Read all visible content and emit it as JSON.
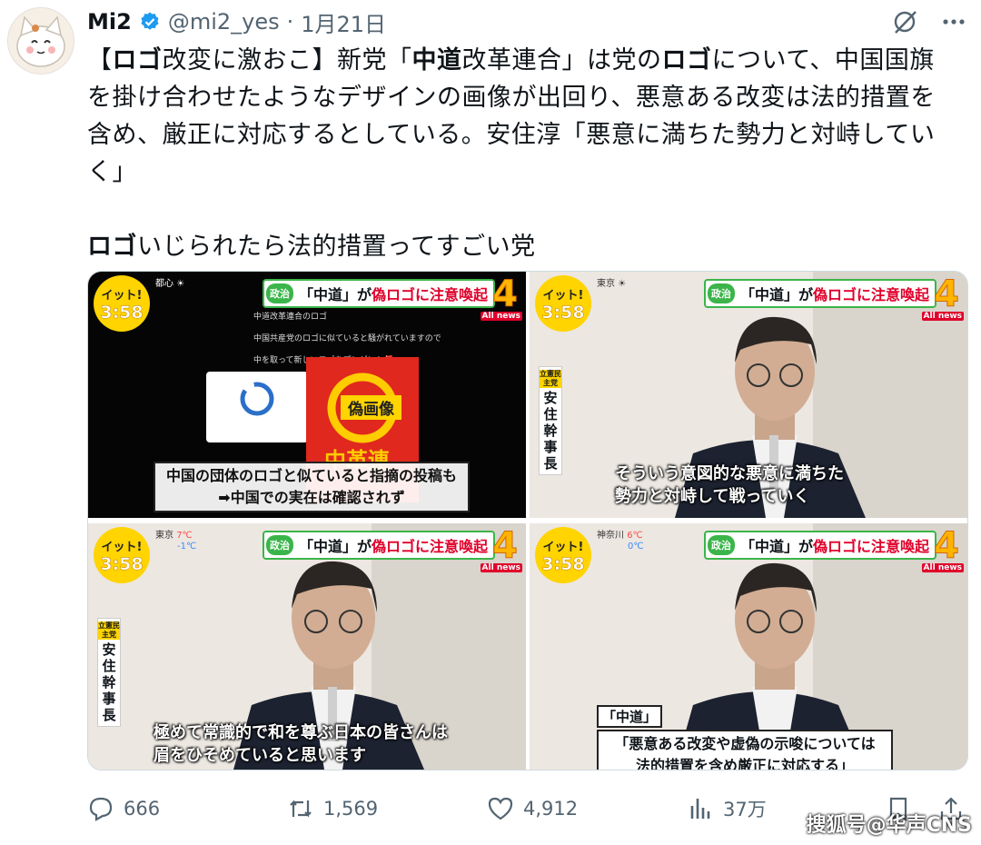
{
  "header": {
    "display_name": "Mi2",
    "handle": "@mi2_yes",
    "separator": "·",
    "date": "1月21日"
  },
  "tweet": {
    "line1_a": "【",
    "line1_b": "ロゴ",
    "line1_c": "改変に激おこ】新党「",
    "line1_d": "中道",
    "line1_e": "改革連合」は党の",
    "line1_f": "ロゴ",
    "line1_g": "について、中国国旗",
    "line2": "を掛け合わせたようなデザインの画像が出回り、悪意ある改変は法的措置を",
    "line3": "含め、厳正に対応するとしている。安住淳「悪意に満ちた勢力と対峙してい",
    "line4": "く」",
    "line5_a": "ロゴ",
    "line5_b": "いじられたら法的措置ってすごい党"
  },
  "media": {
    "itto_label": "イット!",
    "clock": "3:58",
    "topic_tag": "政治",
    "topic_a": "「中道」が",
    "topic_b": "偽ロゴに注意喚起",
    "channel_num": "4",
    "allnews": "All news",
    "frame1": {
      "weather": "都心",
      "line_a": "中道改革連合のロゴ",
      "line_b": "中国共産党のロゴに似ていると騒がれていますので",
      "line_c": "中を取って新しいロゴをプレゼント🎁",
      "fake_label": "偽画像",
      "red_text": "中革連",
      "caption_1": "中国の団体のロゴと似ていると指摘の投稿も",
      "caption_2": "➡中国での実在は確認されず"
    },
    "frame2": {
      "weather": "東京",
      "name_party": "立憲民主党",
      "name": "安住幹事長",
      "sub_1": "そういう意図的な悪意に満ちた",
      "sub_2": "勢力と対峙して戦っていく"
    },
    "frame3": {
      "weather_city": "東京",
      "temp_hi": "7℃",
      "temp_lo": "-1℃",
      "name_party": "立憲民主党",
      "name": "安住幹事長",
      "sub_1": "極めて常識的で和を尊ぶ日本の皆さんは",
      "sub_2": "眉をひそめていると思います"
    },
    "frame4": {
      "weather_city": "神奈川",
      "temp_hi": "6℃",
      "temp_lo": "0℃",
      "tag": "「中道」",
      "quote_1": "「悪意ある改変や虚偽の示唆については",
      "quote_2": "法的措置を含め厳正に対応する」"
    }
  },
  "actions": {
    "replies": "666",
    "reposts": "1,569",
    "likes": "4,912",
    "views": "37万"
  },
  "watermark": "搜狐号@华声CNS",
  "colors": {
    "verified": "#1d9bf0",
    "secondary_text": "#536471",
    "itto_yellow": "#ffd400",
    "topic_green": "#3bb54a",
    "topic_red": "#e0002a"
  }
}
